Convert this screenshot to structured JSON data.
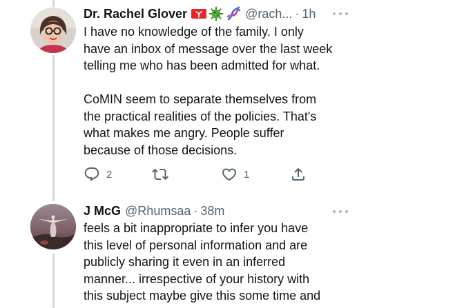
{
  "tweets": [
    {
      "author_name": "Dr. Rachel Glover",
      "emojis": [
        "isle-of-man-flag-icon",
        "virus-icon",
        "dna-icon"
      ],
      "handle": "@rach...",
      "separator": "·",
      "time": "1h",
      "text": "I have no knowledge of the family. I only\nhave an inbox of message over the last week\ntelling me who has been admitted for what.\n\nCoMIN seem to separate themselves from\nthe practical realities of the policies. That's\nwhat makes me angry. People suffer\nbecause of those decisions.",
      "actions": {
        "reply_count": "2",
        "retweet_count": "",
        "like_count": "1"
      }
    },
    {
      "author_name": "J McG",
      "handle": "@Rhumsaa",
      "separator": "·",
      "time": "38m",
      "text": "feels a bit inappropriate to infer you have\nthis level of personal information and are\npublicly sharing it even in an inferred\nmanner... irrespective of your history with\nthis subject maybe give this some time and"
    }
  ],
  "colors": {
    "text": "#0f1419",
    "secondary": "#536471",
    "thread_line": "#cfd9de",
    "flag_red": "#e0282e",
    "virus_green": "#3c8d2f",
    "dna_blue": "#2f6fd6",
    "dna_pink": "#c43fa3"
  }
}
